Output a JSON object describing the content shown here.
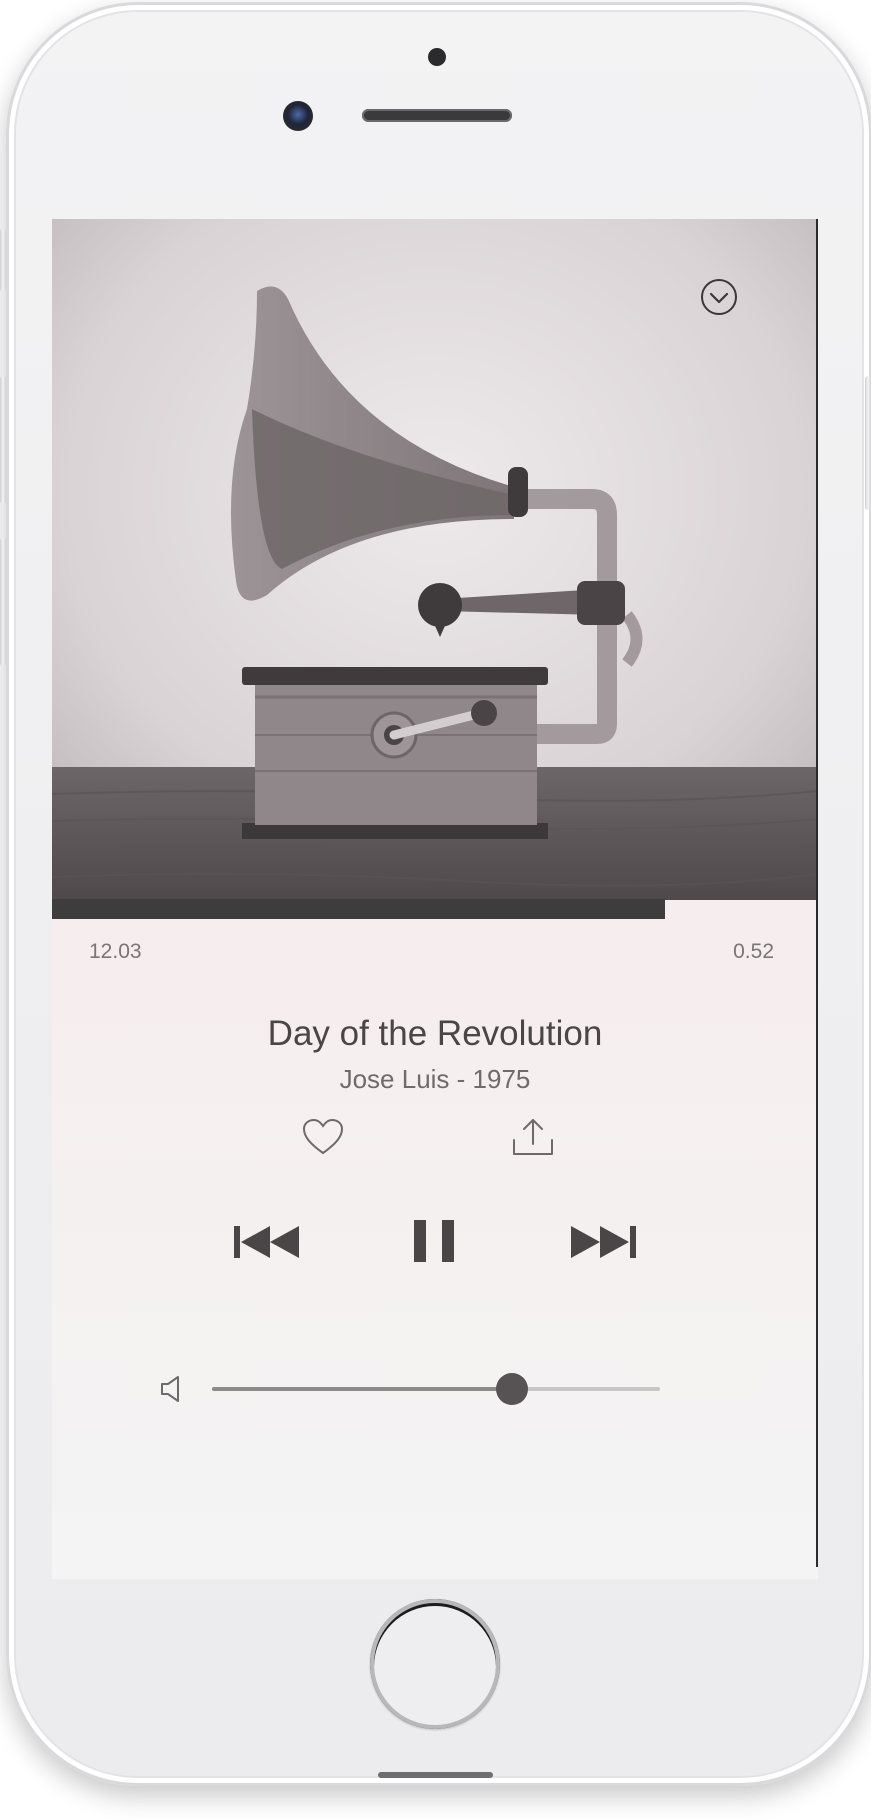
{
  "player": {
    "track_title": "Day of the Revolution",
    "track_subtitle": "Jose Luis - 1975",
    "elapsed": "12.03",
    "remaining": "0.52",
    "progress_fraction": 0.8,
    "volume_fraction": 0.67,
    "state": "playing"
  },
  "icons": {
    "collapse": "chevron-down-circle-icon",
    "like": "heart-icon",
    "share": "share-icon",
    "previous": "skip-previous-icon",
    "pause": "pause-icon",
    "next": "skip-next-icon",
    "volume": "speaker-icon"
  },
  "colors": {
    "background": "#f7eded",
    "controls": "#4a4647",
    "progress": "#3f3c3d"
  }
}
